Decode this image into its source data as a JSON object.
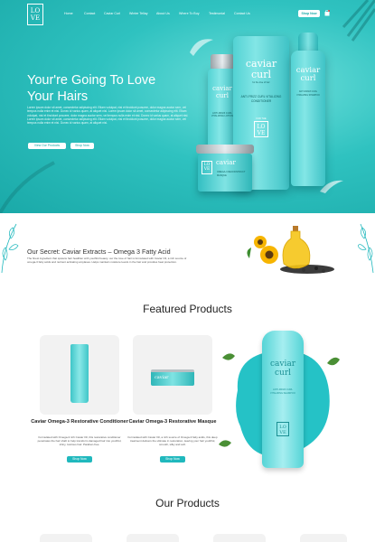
{
  "header": {
    "logo": "LO VE",
    "nav": [
      "Home",
      "Contact",
      "Caviar Curl",
      "Winter Tellay",
      "About Us",
      "Where To Buy",
      "Testimonial",
      "Contact Us"
    ],
    "shop_now": "Shop Now"
  },
  "hero": {
    "title": "Your're Going To Love Your Hairs",
    "description": "Lorem ipsum dolor sit amet, consectetur adipiscing elit. Etiam volutpat, nisi et tincidunt posuere, dolor magna auctor sem, vel tempus nulla enim et nisi. Donec id varius quam, at aliquet nisl. Lorem ipsum dolor sit amet, consectetur adipiscing elit. Etiam volutpat, nisi et tincidunt posuere, dolor magna auctor sem, vel tempus nulla enim et nisi. Donec id varius quam, at aliquet nisl. Lorem ipsum dolor sit amet, consectetur adipiscing elit. Etiam volutpat, nisi et tincidunt posuere, dolor magna auctor sem, vel tempus nulla enim et nisi. Donec id varius quam, at aliquet nisl.",
    "view_button": "View Our Products",
    "shop_button": "Shop Now",
    "products": {
      "brand_top": "caviar",
      "brand_bottom": "curl",
      "tagline": "for the love of hair",
      "conditioner_label": "ANTI-FRIZZ CURL VITALIZING CONDITIONER",
      "shampoo_label": "ANTI-FRIZZ CURL VITALIZING SHAMPOO",
      "lotion_label": "ANTI-FRIZZ CURL VITALIZING LOTION",
      "masque_label": "OMEGA-3 RECONSTRUCT MASQUE",
      "love_logo": "LO VE",
      "for_the": "FOR THE"
    }
  },
  "secret": {
    "title": "Our Secret: Caviar Extracts – Omega 3 Fatty Acid",
    "description": "The finest ingredient that spawns hair healthier with youthful beauty. our the love of hair is formulated with Caviar Oil, a rich source of omega-3 fatty acids and nutrient activating amylases. Helps maintain moisture levels in the hair and provides heat protection."
  },
  "featured": {
    "title": "Featured Products",
    "items": [
      {
        "name": "Caviar Omega-3 Restorative Conditioner",
        "description": "Formulated with Omega-3 rich Caviar Oil, this restorative conditioner penetrates the hair shaft to help transform damaged hair into youthful, shiny, lustrous hair. Paraben-free.",
        "button": "Shop Now"
      },
      {
        "name": "Caviar Omega-3 Restorative Masque",
        "description": "Formulated with Caviar Oil, a rich source of Omega-3 fatty acids, this deep treatment delivers the ultimate in restoration, leaving your hair youthful, smooth, silky and soft.",
        "button": "Shop Now"
      }
    ]
  },
  "products": {
    "title": "Our Products"
  },
  "colors": {
    "accent": "#20b8bd",
    "hero_bg": "#2fc2c0"
  }
}
